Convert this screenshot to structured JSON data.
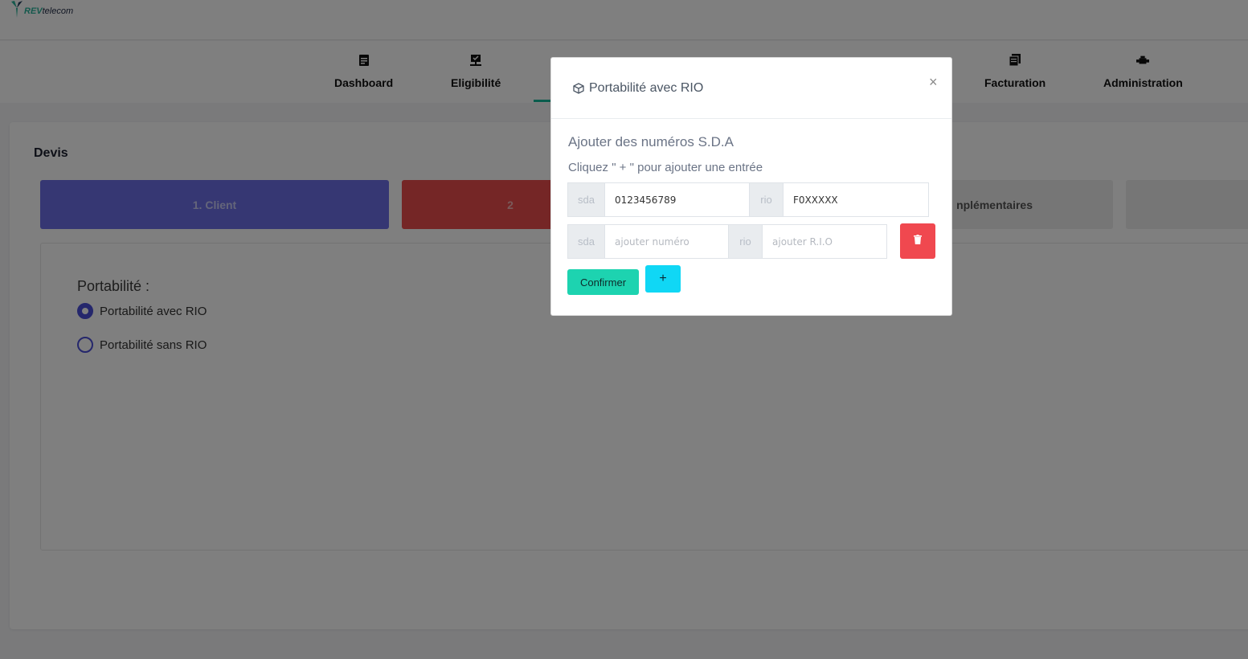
{
  "brand": {
    "name_prefix": "REV",
    "name_suffix": "telecom",
    "logo_icon": "leaf-logo-icon"
  },
  "nav": {
    "items": [
      {
        "label": "Dashboard",
        "icon": "document-icon"
      },
      {
        "label": "Eligibilité",
        "icon": "monitor-icon"
      },
      {
        "label": "Facturation",
        "icon": "book-icon"
      },
      {
        "label": "Administration",
        "icon": "tools-icon"
      }
    ],
    "active_color": "#15b89a"
  },
  "page": {
    "title": "Devis",
    "steps": [
      {
        "label": "1. Client",
        "color": "#6c6fe6"
      },
      {
        "label": "2",
        "color": "#ea4d4d"
      },
      {
        "label": "nplémentaires",
        "color": "#ececec"
      },
      {
        "label": "",
        "color": "#ececec"
      }
    ],
    "portability": {
      "title": "Portabilité :",
      "options": [
        {
          "label": "Portabilité avec RIO",
          "checked": true
        },
        {
          "label": "Portabilité sans RIO",
          "checked": false
        }
      ]
    }
  },
  "modal": {
    "title": "Portabilité avec RIO",
    "title_icon": "cube-icon",
    "close_label": "×",
    "subtitle": "Ajouter des numéros S.D.A",
    "hint": "Cliquez \" + \" pour ajouter une entrée",
    "rows": [
      {
        "sda_addon": "sda",
        "sda_value": "0123456789",
        "rio_addon": "rio",
        "rio_value": "F0XXXXX"
      },
      {
        "sda_addon": "sda",
        "sda_placeholder": "ajouter numéro",
        "rio_addon": "rio",
        "rio_placeholder": "ajouter R.I.O"
      }
    ],
    "confirm_label": "Confirmer",
    "add_label": "+",
    "delete_icon": "trash-icon",
    "delete_color": "#f0484f",
    "confirm_color": "#1dd3b0",
    "add_color": "#10d7f5"
  }
}
